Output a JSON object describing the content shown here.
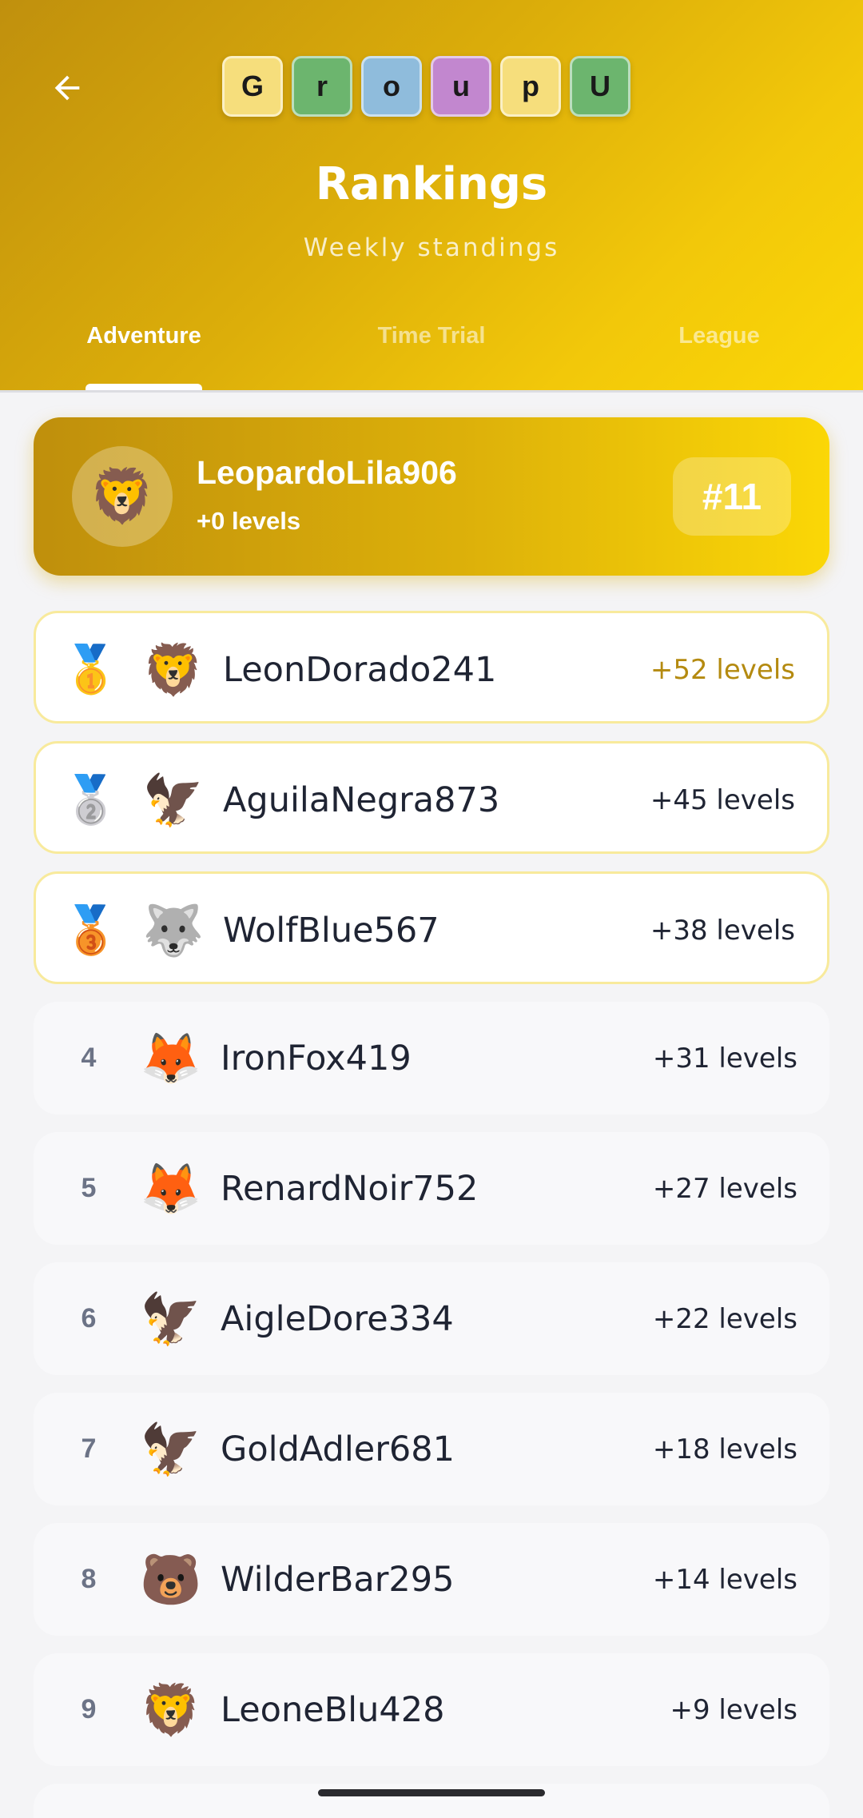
{
  "header": {
    "logo_letters": [
      {
        "letter": "G",
        "color": "#f6de7c"
      },
      {
        "letter": "r",
        "color": "#6cb56e"
      },
      {
        "letter": "o",
        "color": "#8fbcdc"
      },
      {
        "letter": "u",
        "color": "#c287cf"
      },
      {
        "letter": "p",
        "color": "#f6de7c"
      },
      {
        "letter": "U",
        "color": "#6cb56e"
      }
    ],
    "title": "Rankings",
    "subtitle": "Weekly standings"
  },
  "tabs": [
    {
      "label": "Adventure",
      "active": true
    },
    {
      "label": "Time Trial",
      "active": false
    },
    {
      "label": "League",
      "active": false
    }
  ],
  "current_user": {
    "avatar": "🦁",
    "name": "LeopardoLila906",
    "levels": "+0 levels",
    "rank": "#11"
  },
  "leaderboard": [
    {
      "rank": "1",
      "medal": "🥇",
      "avatar": "🦁",
      "name": "LeonDorado241",
      "levels": "+52 levels"
    },
    {
      "rank": "2",
      "medal": "🥈",
      "avatar": "🦅",
      "name": "AguilaNegra873",
      "levels": "+45 levels"
    },
    {
      "rank": "3",
      "medal": "🥉",
      "avatar": "🐺",
      "name": "WolfBlue567",
      "levels": "+38 levels"
    },
    {
      "rank": "4",
      "medal": "",
      "avatar": "🦊",
      "name": "IronFox419",
      "levels": "+31 levels"
    },
    {
      "rank": "5",
      "medal": "",
      "avatar": "🦊",
      "name": "RenardNoir752",
      "levels": "+27 levels"
    },
    {
      "rank": "6",
      "medal": "",
      "avatar": "🦅",
      "name": "AigleDore334",
      "levels": "+22 levels"
    },
    {
      "rank": "7",
      "medal": "",
      "avatar": "🦅",
      "name": "GoldAdler681",
      "levels": "+18 levels"
    },
    {
      "rank": "8",
      "medal": "",
      "avatar": "🐻",
      "name": "WilderBar295",
      "levels": "+14 levels"
    },
    {
      "rank": "9",
      "medal": "",
      "avatar": "🦁",
      "name": "LeoneBlu428",
      "levels": "+9 levels"
    },
    {
      "rank": "",
      "medal": "",
      "avatar": "🐯",
      "name": "",
      "levels": ""
    }
  ],
  "icons": {
    "back": "arrow-left-icon"
  },
  "colors": {
    "accent_gold": "#e3b40a",
    "first_place_levels": "#b48a10"
  }
}
